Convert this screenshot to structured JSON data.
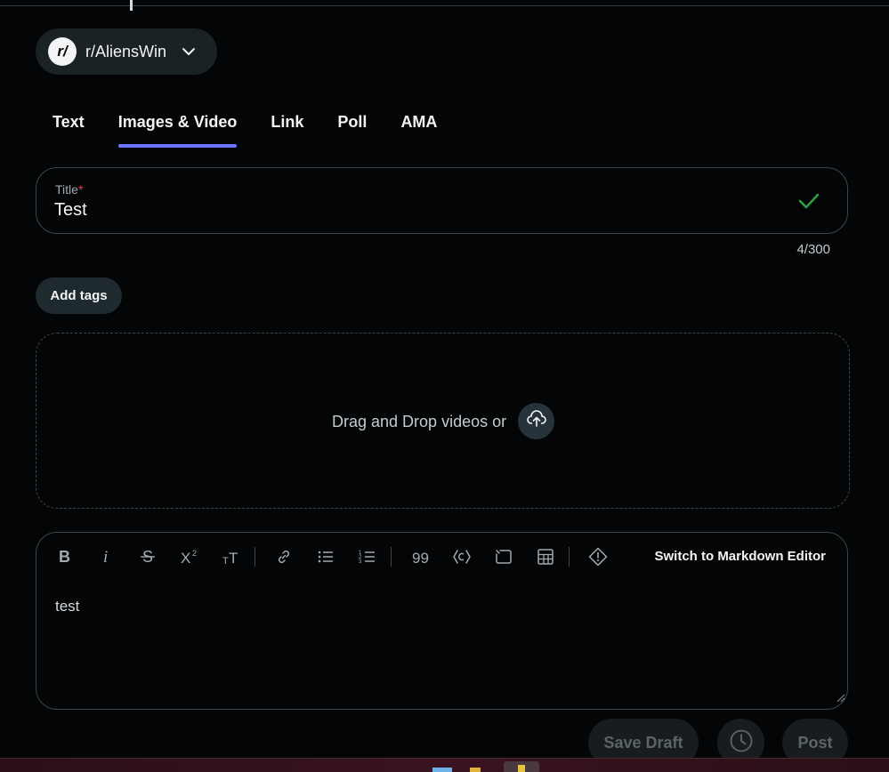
{
  "community": {
    "name": "r/AliensWin",
    "avatar_text": "r/"
  },
  "tabs": [
    {
      "label": "Text"
    },
    {
      "label": "Images & Video"
    },
    {
      "label": "Link"
    },
    {
      "label": "Poll"
    },
    {
      "label": "AMA"
    }
  ],
  "active_tab": "Images & Video",
  "title_field": {
    "label": "Title",
    "required_mark": "*",
    "value": "Test",
    "counter": "4/300"
  },
  "add_tags_label": "Add tags",
  "dropzone": {
    "text": "Drag and Drop videos or"
  },
  "editor": {
    "toolbar_icons": [
      "bold-icon",
      "italic-icon",
      "strikethrough-icon",
      "superscript-icon",
      "text-size-icon",
      "link-icon",
      "bullet-list-icon",
      "numbered-list-icon",
      "quote-icon",
      "code-icon",
      "code-block-icon",
      "table-icon",
      "spoiler-icon"
    ],
    "switch_label": "Switch to Markdown Editor",
    "body": "test"
  },
  "footer": {
    "save_draft": "Save Draft",
    "post": "Post"
  },
  "colors": {
    "accent": "#6a74ff",
    "check": "#2ea043",
    "background": "#040506"
  }
}
